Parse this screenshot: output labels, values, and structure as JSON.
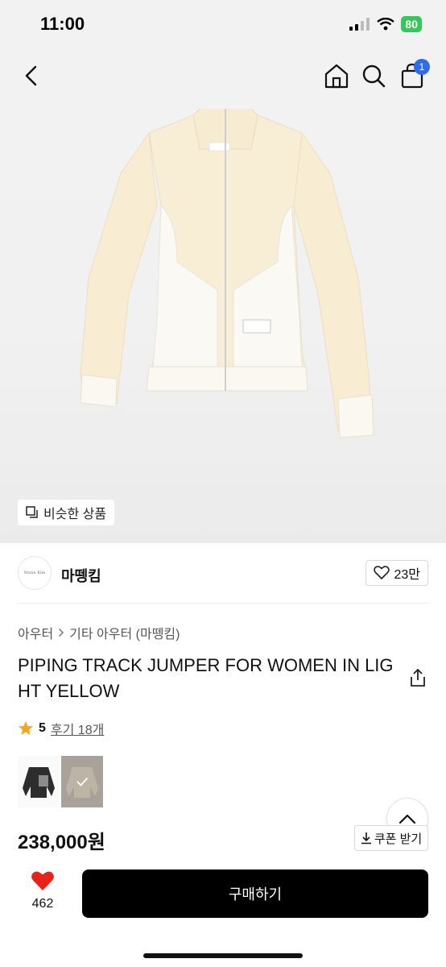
{
  "status_bar": {
    "time": "11:00",
    "battery": "80"
  },
  "nav": {
    "cart_count": "1",
    "icons": [
      "back-chevron-icon",
      "home-icon",
      "search-icon",
      "shopping-bag-icon"
    ]
  },
  "hero": {
    "similar_products_label": "비슷한 상품",
    "label_text": "Matin Kim"
  },
  "brand": {
    "logo_text": "Matin Kim",
    "name": "마뗑킴",
    "likes": "23만"
  },
  "breadcrumb": {
    "level1": "아우터",
    "level2": "기타 아우터 (마뗑킴)"
  },
  "product": {
    "title": "PIPING TRACK JUMPER FOR WOMEN IN LIGHT YELLOW",
    "rating": "5",
    "reviews": "후기 18개",
    "price": "238,000원",
    "coupon_label": "쿠폰 받기"
  },
  "bottom_bar": {
    "wish_count": "462",
    "buy_label": "구매하기"
  },
  "colors": {
    "accent_badge": "#2f6bf0",
    "heart": "#e8221b",
    "star": "#f5a623",
    "battery": "#34c759",
    "buy_button": "#000000"
  }
}
